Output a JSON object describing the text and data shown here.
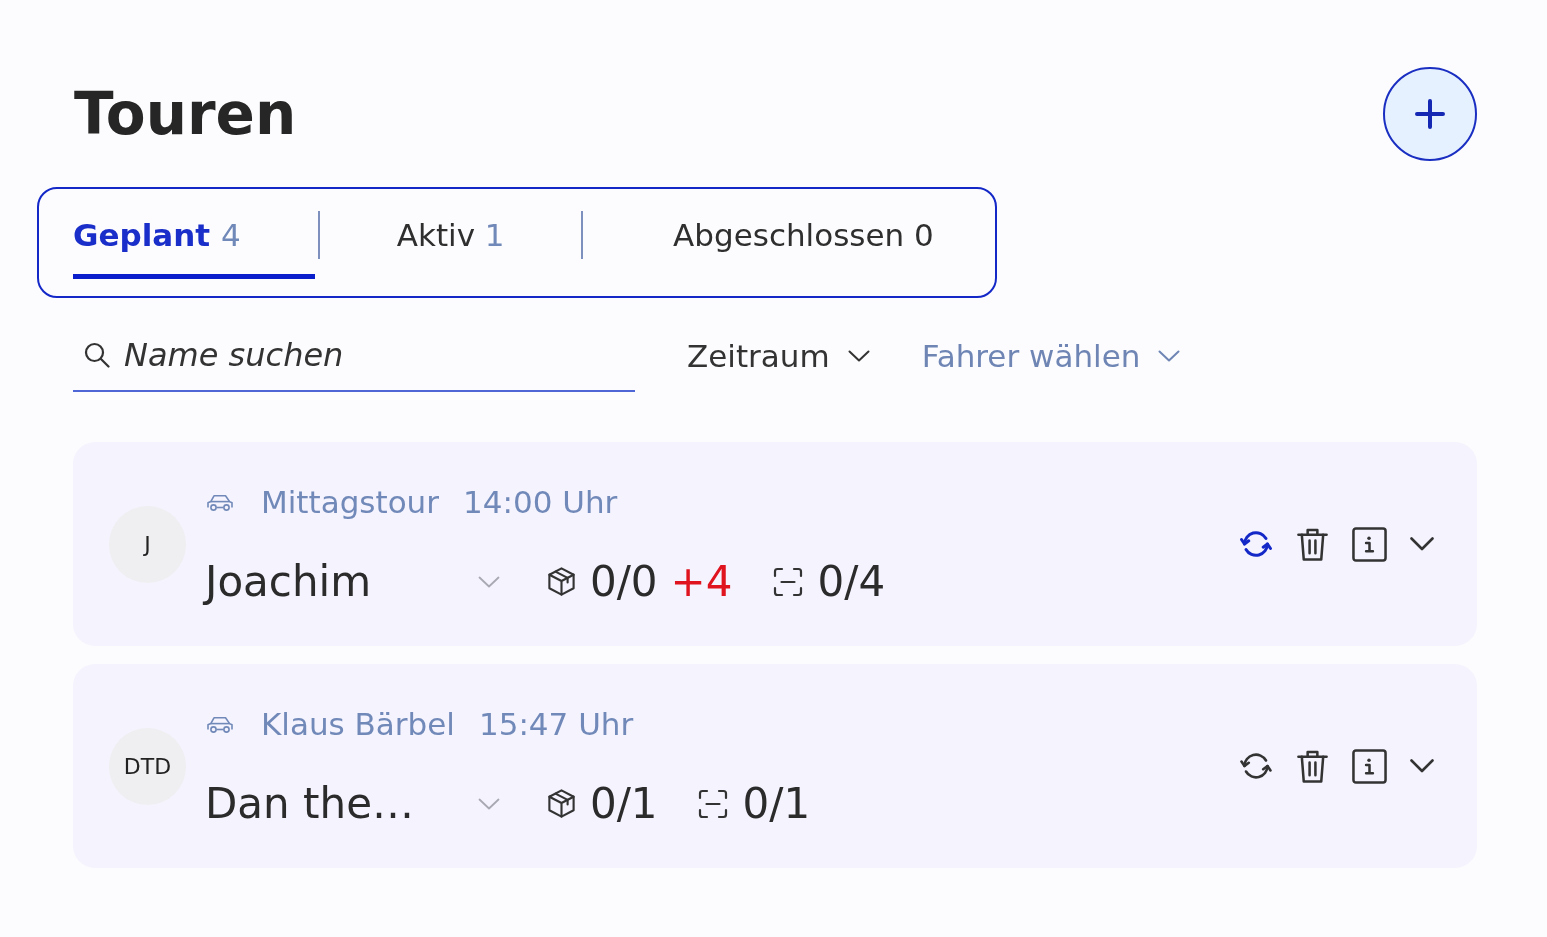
{
  "title": "Touren",
  "tabs": [
    {
      "label": "Geplant",
      "count": "4",
      "selected": true,
      "count_highlighted": true
    },
    {
      "label": "Aktiv",
      "count": "1",
      "selected": false,
      "count_highlighted": true
    },
    {
      "label": "Abgeschlossen",
      "count": "0",
      "selected": false,
      "count_highlighted": false
    }
  ],
  "search": {
    "placeholder": "Name suchen"
  },
  "filters": [
    {
      "label": "Zeitraum",
      "muted": false
    },
    {
      "label": "Fahrer wählen",
      "muted": true
    }
  ],
  "tours": [
    {
      "initials": "J",
      "name": "Mittagstour",
      "time": "14:00 Uhr",
      "driver": "Joachim",
      "packages": "0/0",
      "packages_extra": "+4",
      "scans": "0/4",
      "sync_highlighted": true
    },
    {
      "initials": "DTD",
      "name": "Klaus Bärbel",
      "time": "15:47 Uhr",
      "driver": "Dan the…",
      "packages": "0/1",
      "scans": "0/1",
      "sync_highlighted": false
    }
  ]
}
